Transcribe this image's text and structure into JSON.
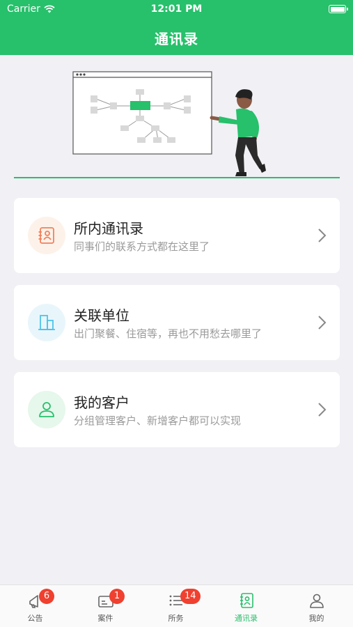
{
  "status_bar": {
    "carrier": "Carrier",
    "time": "12:01 PM"
  },
  "header": {
    "title": "通讯录"
  },
  "cards": [
    {
      "title": "所内通讯录",
      "subtitle": "同事们的联系方式都在这里了",
      "icon": "contact-card-icon",
      "icon_bg": "#fdf2ea",
      "icon_color": "#f0805a"
    },
    {
      "title": "关联单位",
      "subtitle": "出门聚餐、住宿等，再也不用愁去哪里了",
      "icon": "building-icon",
      "icon_bg": "#e8f6fb",
      "icon_color": "#4fc3e8"
    },
    {
      "title": "我的客户",
      "subtitle": "分组管理客户、新增客户都可以实现",
      "icon": "person-icon",
      "icon_bg": "#e6f7ec",
      "icon_color": "#27c06b"
    }
  ],
  "tabs": [
    {
      "label": "公告",
      "icon": "megaphone-icon",
      "badge": "6"
    },
    {
      "label": "案件",
      "icon": "case-icon",
      "badge": "1"
    },
    {
      "label": "所务",
      "icon": "list-icon",
      "badge": "14"
    },
    {
      "label": "通讯录",
      "icon": "contacts-icon",
      "active": true
    },
    {
      "label": "我的",
      "icon": "profile-icon"
    }
  ],
  "colors": {
    "brand": "#27c06b",
    "badge": "#f0402f"
  }
}
